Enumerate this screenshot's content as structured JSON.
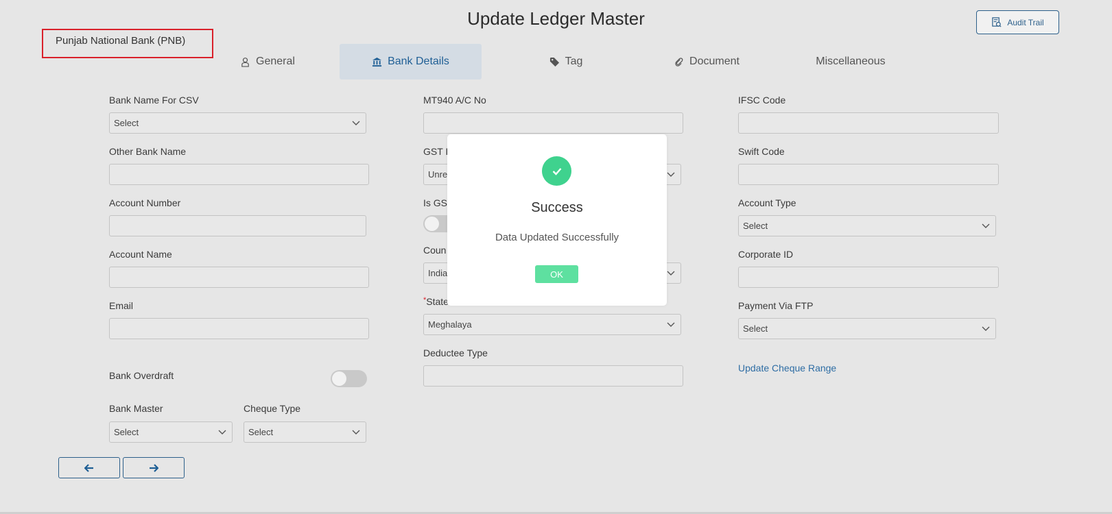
{
  "header": {
    "title": "Update Ledger Master",
    "audit_label": "Audit Trail",
    "ledger_name": "Punjab National Bank (PNB)"
  },
  "tabs": [
    {
      "label": "General",
      "icon": "user-icon"
    },
    {
      "label": "Bank Details",
      "icon": "bank-icon",
      "active": true
    },
    {
      "label": "Tag",
      "icon": "tag-icon"
    },
    {
      "label": "Document",
      "icon": "paperclip-icon"
    },
    {
      "label": "Miscellaneous"
    }
  ],
  "form": {
    "col1": {
      "bank_name_csv": {
        "label": "Bank Name For CSV",
        "value": "Select"
      },
      "other_bank_name": {
        "label": "Other Bank Name",
        "value": ""
      },
      "account_number": {
        "label": "Account Number",
        "value": ""
      },
      "account_name": {
        "label": "Account Name",
        "value": ""
      },
      "email": {
        "label": "Email",
        "value": ""
      },
      "bank_overdraft": {
        "label": "Bank Overdraft",
        "on": false
      },
      "bank_master": {
        "label": "Bank Master",
        "value": "Select"
      },
      "cheque_type": {
        "label": "Cheque Type",
        "value": "Select"
      }
    },
    "col2": {
      "mt940": {
        "label": "MT940 A/C No",
        "value": ""
      },
      "gst": {
        "label": "GST I",
        "value": "Unre"
      },
      "is_gst": {
        "label": "Is GS",
        "on": false
      },
      "country": {
        "label": "Coun",
        "value": "India"
      },
      "state": {
        "label": "State",
        "value": "Meghalaya",
        "required_mark": "*"
      },
      "deductee_type": {
        "label": "Deductee Type",
        "value": ""
      }
    },
    "col3": {
      "ifsc": {
        "label": "IFSC Code",
        "value": ""
      },
      "swift": {
        "label": "Swift Code",
        "value": ""
      },
      "account_type": {
        "label": "Account Type",
        "value": "Select"
      },
      "corporate_id": {
        "label": "Corporate ID",
        "value": ""
      },
      "payment_ftp": {
        "label": "Payment Via FTP",
        "value": "Select"
      },
      "update_cheque_range": "Update Cheque Range"
    }
  },
  "modal": {
    "title": "Success",
    "message": "Data Updated Successfully",
    "ok_label": "OK",
    "icon": "check-icon"
  },
  "colors": {
    "accent": "#1f5f95",
    "success": "#3fd28e",
    "highlight_border": "#d9202a"
  }
}
